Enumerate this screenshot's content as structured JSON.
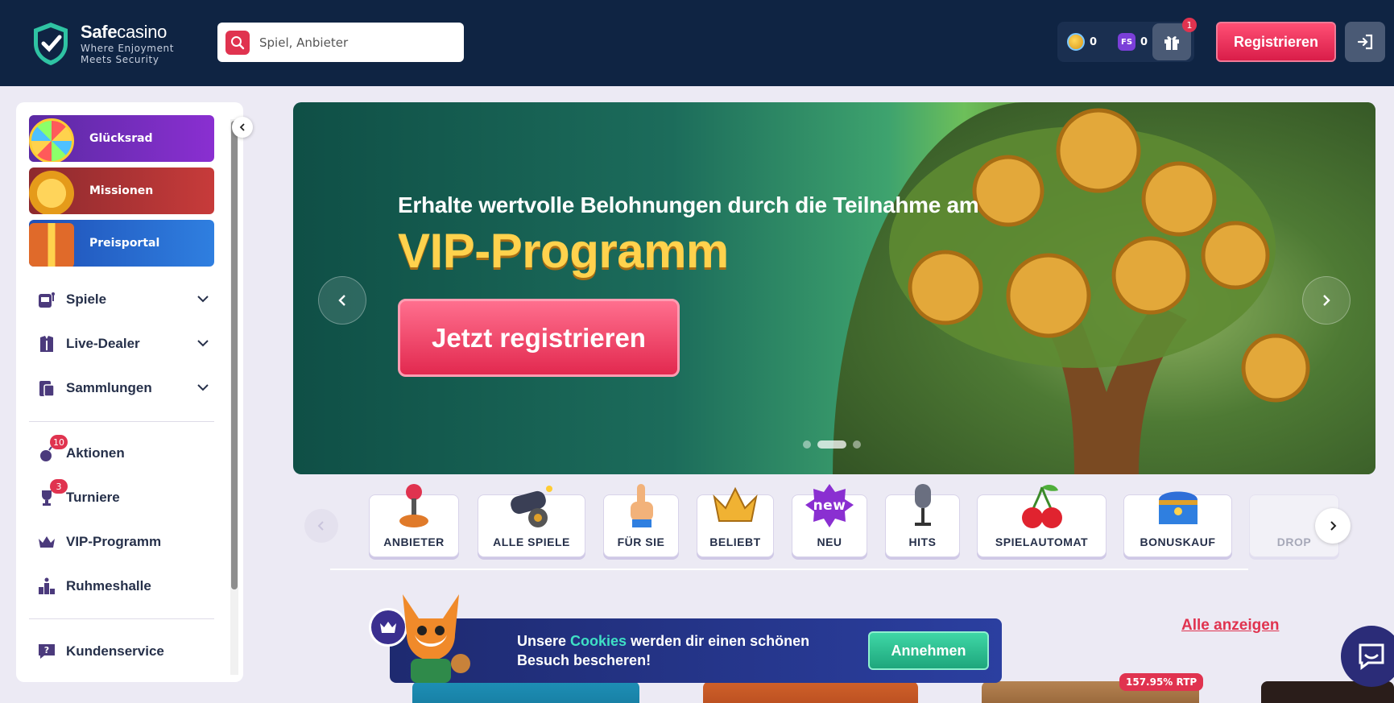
{
  "header": {
    "brand_bold": "Safe",
    "brand_light": "casino",
    "tagline_1": "Where Enjoyment",
    "tagline_2": "Meets Security",
    "search_placeholder": "Spiel, Anbieter",
    "coins": "0",
    "fs_label": "FS",
    "freespins": "0",
    "gift_badge": "1",
    "register_label": "Registrieren"
  },
  "sidebar": {
    "promos": [
      {
        "label": "Glücksrad"
      },
      {
        "label": "Missionen"
      },
      {
        "label": "Preisportal"
      }
    ],
    "nav": [
      {
        "label": "Spiele"
      },
      {
        "label": "Live-Dealer"
      },
      {
        "label": "Sammlungen"
      },
      {
        "label": "Aktionen",
        "badge": "10"
      },
      {
        "label": "Turniere",
        "badge": "3"
      },
      {
        "label": "VIP-Programm"
      },
      {
        "label": "Ruhmeshalle"
      },
      {
        "label": "Kundenservice"
      }
    ]
  },
  "banner": {
    "subtitle": "Erhalte wertvolle Belohnungen durch die Teilnahme am",
    "title": "VIP-Programm",
    "cta": "Jetzt registrieren"
  },
  "categories": [
    {
      "label": "ANBIETER"
    },
    {
      "label": "ALLE SPIELE"
    },
    {
      "label": "FÜR SIE"
    },
    {
      "label": "BELIEBT"
    },
    {
      "label": "NEU",
      "image_text": "new"
    },
    {
      "label": "HITS"
    },
    {
      "label": "SPIELAUTOMAT"
    },
    {
      "label": "BONUSKAUF"
    },
    {
      "label": "DROP"
    }
  ],
  "section": {
    "see_all": "Alle anzeigen",
    "rtp_badge": "157.95% RTP"
  },
  "cookie": {
    "text_1": "Unsere ",
    "highlight": "Cookies",
    "text_2": " werden dir einen schönen Besuch bescheren!",
    "accept": "Annehmen"
  },
  "colors": {
    "header_bg": "#0f2443",
    "accent_red": "#e0334f",
    "cookie_green": "#3fd7a6"
  }
}
